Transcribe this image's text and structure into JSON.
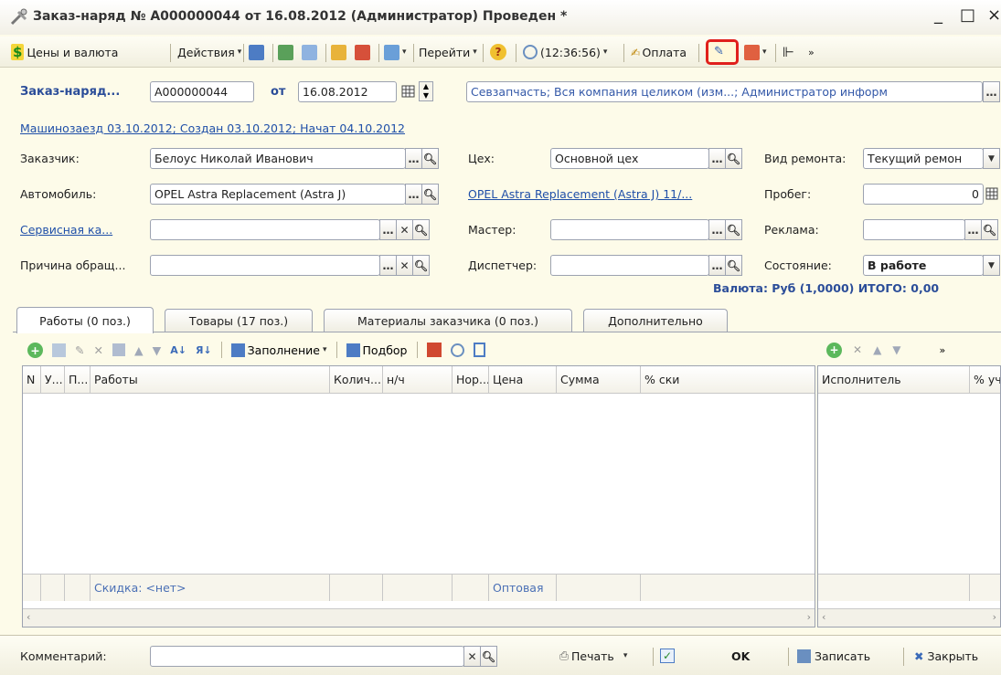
{
  "window": {
    "title": "Заказ-наряд № А000000044 от 16.08.2012 (Администратор) Проведен *",
    "controls": [
      "_",
      "□",
      "×"
    ]
  },
  "toolbar": {
    "prices": "Цены и валюта",
    "actions": "Действия",
    "goto": "Перейти",
    "time": "(12:36:56)",
    "payment": "Оплата"
  },
  "header": {
    "doc_label": "Заказ-наряд...",
    "doc_number": "А000000044",
    "from_label": "от",
    "date": "16.08.2012",
    "org": "Севзапчасть; Вся компания целиком (изм...; Администратор информ",
    "info_link": "Машинозаезд 03.10.2012; Создан 03.10.2012; Начат 04.10.2012"
  },
  "form": {
    "customer_label": "Заказчик:",
    "customer_value": "Белоус Николай Иванович",
    "car_label": "Автомобиль:",
    "car_value": "OPEL  Astra Replacement (Astra J)",
    "card_label": "Сервисная ка...",
    "reason_label": "Причина обращ...",
    "shop_label": "Цех:",
    "shop_value": "Основной цех",
    "car_link": "OPEL  Astra Replacement (Astra J) 11/...",
    "master_label": "Мастер:",
    "dispatcher_label": "Диспетчер:",
    "repair_label": "Вид ремонта:",
    "repair_value": "Текущий ремон",
    "mileage_label": "Пробег:",
    "mileage_value": "0",
    "ad_label": "Реклама:",
    "state_label": "Состояние:",
    "state_value": "В работе",
    "currency_total": "Валюта: Руб (1,0000) ИТОГО: 0,00"
  },
  "tabs": [
    {
      "label": "Работы (0 поз.)"
    },
    {
      "label": "Товары (17 поз.)"
    },
    {
      "label": "Материалы заказчика (0 поз.)"
    },
    {
      "label": "Дополнительно"
    }
  ],
  "grid_toolbar": {
    "fill": "Заполнение",
    "pick": "Подбор"
  },
  "grid": {
    "columns": [
      "N",
      "У...",
      "П...",
      "Работы",
      "Колич...",
      "н/ч",
      "Нор...",
      "Цена",
      "Сумма",
      "% ски"
    ],
    "footer_discount": "Скидка: <нет>",
    "footer_price_type": "Оптовая"
  },
  "grid2": {
    "columns": [
      "Исполнитель",
      "% уч"
    ]
  },
  "footer": {
    "comment_label": "Комментарий:",
    "print": "Печать",
    "ok": "OK",
    "save": "Записать",
    "close": "Закрыть"
  },
  "colors": {
    "accent_blue": "#2b4d99",
    "highlight_red": "#e0201c",
    "background": "#fdfbe9"
  }
}
